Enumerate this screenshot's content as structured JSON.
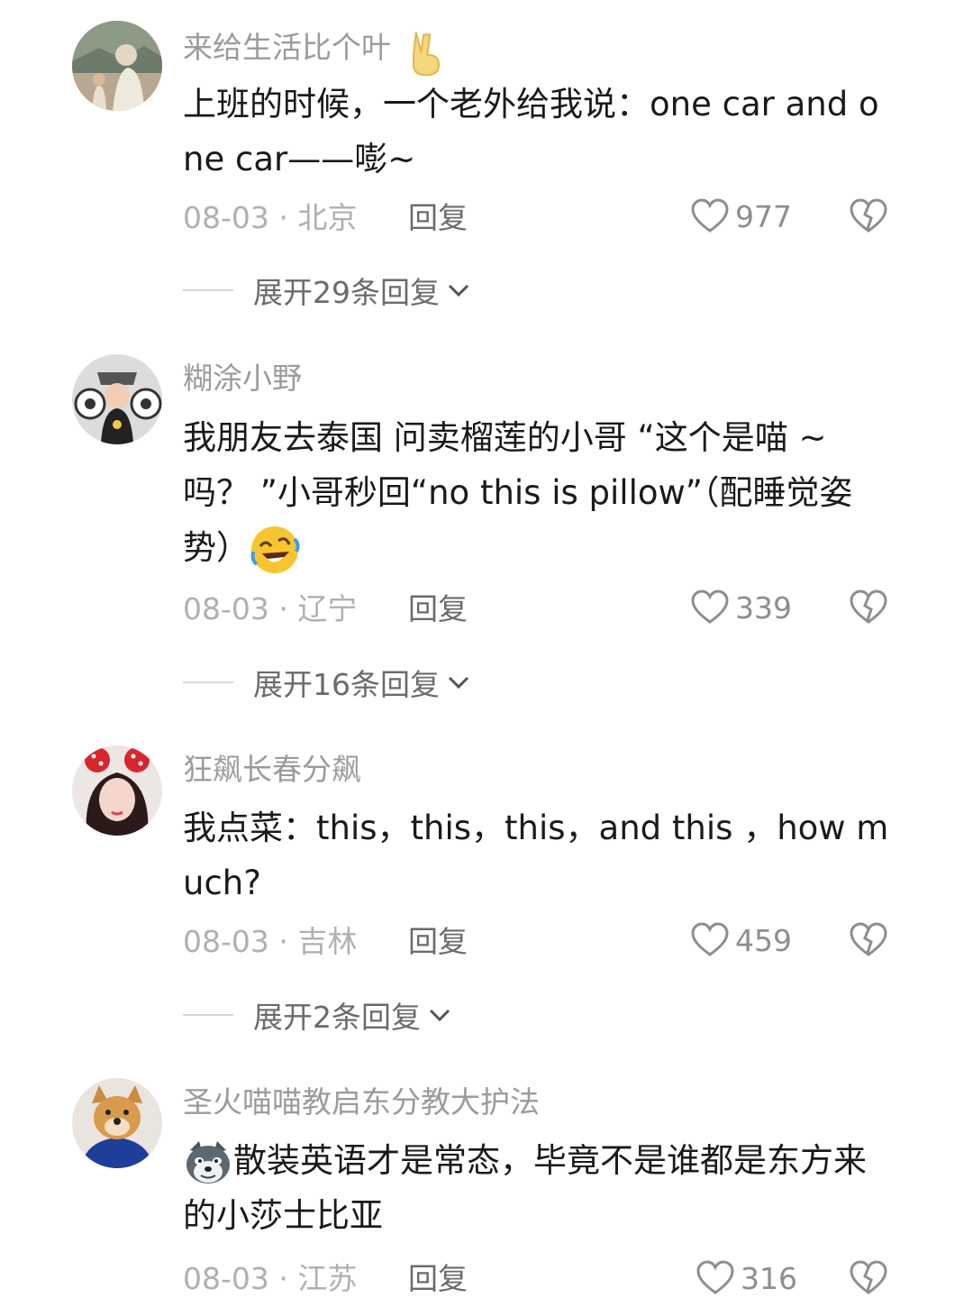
{
  "comments": [
    {
      "username": "来给生活比个叶",
      "username_emoji": "victory-hand-emoji",
      "text": "上班的时候，一个老外给我说：one car and one car——嘭~",
      "date": "08-03",
      "separator": "·",
      "location": "北京",
      "reply_label": "回复",
      "likes": "977",
      "expand_label": "展开29条回复"
    },
    {
      "username": "糊涂小野",
      "text": "我朋友去泰国 问卖榴莲的小哥 “这个是喵 ~ 吗？ ”小哥秒回“no this is pillow”（配睡觉姿势）",
      "text_emoji": "rolling-laughing-emoji",
      "date": "08-03",
      "separator": "·",
      "location": "辽宁",
      "reply_label": "回复",
      "likes": "339",
      "expand_label": "展开16条回复"
    },
    {
      "username": "狂飙长春分飙",
      "text": "我点菜：this，this，this，and this ，how much?",
      "date": "08-03",
      "separator": "·",
      "location": "吉林",
      "reply_label": "回复",
      "likes": "459",
      "expand_label": "展开2条回复"
    },
    {
      "username": "圣火喵喵教启东分教大护法",
      "text_emoji": "wolf-face-emoji",
      "text": "散装英语才是常态，毕竟不是谁都是东方来的小莎士比亚",
      "date": "08-03",
      "separator": "·",
      "location": "江苏",
      "reply_label": "回复",
      "likes": "316"
    }
  ],
  "icons": {
    "like": "heart-outline-icon",
    "dislike": "broken-heart-icon",
    "expand": "chevron-down-icon"
  },
  "colors": {
    "username": "#9b9b9b",
    "body": "#1a1a1a",
    "meta": "#b0b0b0",
    "reply": "#6b6b6b",
    "emoji_yellow": "#f7c531"
  }
}
